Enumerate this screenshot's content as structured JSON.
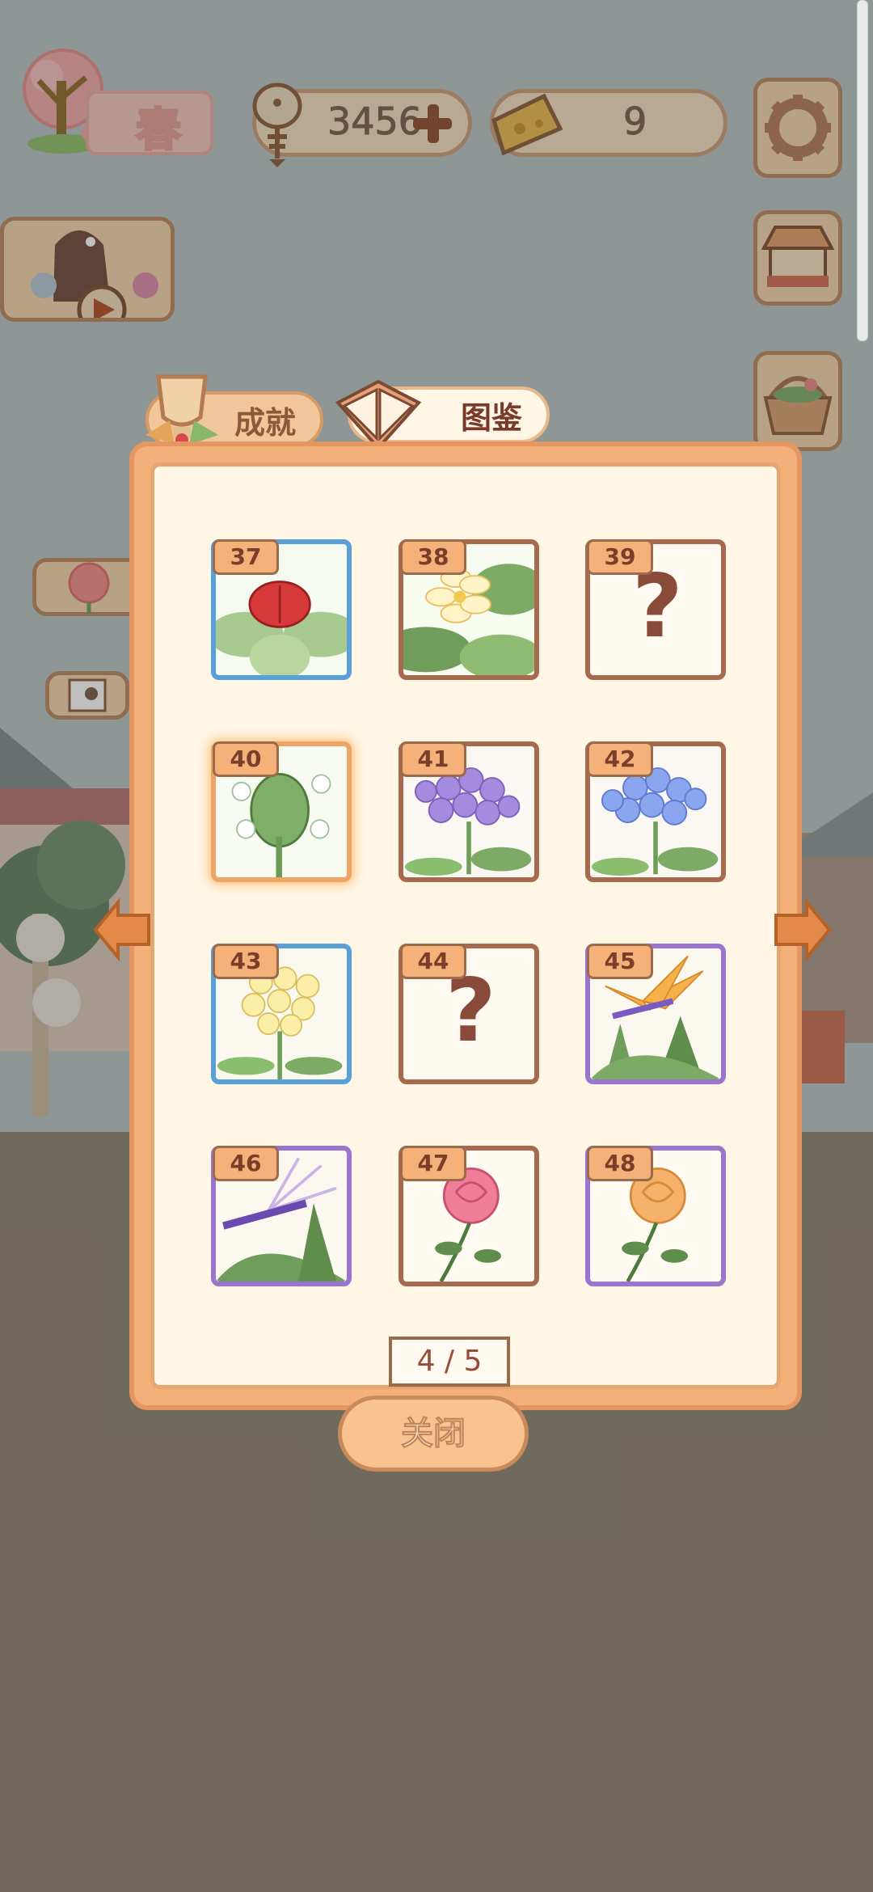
{
  "hud": {
    "season": "春",
    "fish_count": "3456",
    "cheese_count": "9"
  },
  "tabs": [
    {
      "label": "成就"
    },
    {
      "label": "图鉴"
    }
  ],
  "cards": [
    {
      "number": "37",
      "frame": "blue",
      "discovered": true,
      "plant": "red flower bud"
    },
    {
      "number": "38",
      "frame": "brown",
      "discovered": true,
      "plant": "plumeria"
    },
    {
      "number": "39",
      "frame": "brown",
      "discovered": false,
      "mystery": "?"
    },
    {
      "number": "40",
      "frame": "gold",
      "discovered": true,
      "plant": "green bud with white flowers"
    },
    {
      "number": "41",
      "frame": "brown",
      "discovered": true,
      "plant": "purple hydrangea"
    },
    {
      "number": "42",
      "frame": "brown",
      "discovered": true,
      "plant": "blue hydrangea"
    },
    {
      "number": "43",
      "frame": "blue",
      "discovered": true,
      "plant": "yellow flower cluster"
    },
    {
      "number": "44",
      "frame": "brown",
      "discovered": false,
      "mystery": "?"
    },
    {
      "number": "45",
      "frame": "purple",
      "discovered": true,
      "plant": "bird of paradise orange"
    },
    {
      "number": "46",
      "frame": "purple",
      "discovered": true,
      "plant": "bird of paradise white"
    },
    {
      "number": "47",
      "frame": "brown",
      "discovered": true,
      "plant": "pink rose"
    },
    {
      "number": "48",
      "frame": "purple",
      "discovered": true,
      "plant": "orange rose"
    }
  ],
  "pager": "4 / 5",
  "close_label": "关闭",
  "colors": {
    "panel": "#f3b07a",
    "panel_inner": "#fff6e6",
    "rare_blue": "#5aa0d8",
    "rare_purple": "#9a74cf",
    "common_brown": "#a76a4f",
    "selected_gold": "#eea465"
  }
}
